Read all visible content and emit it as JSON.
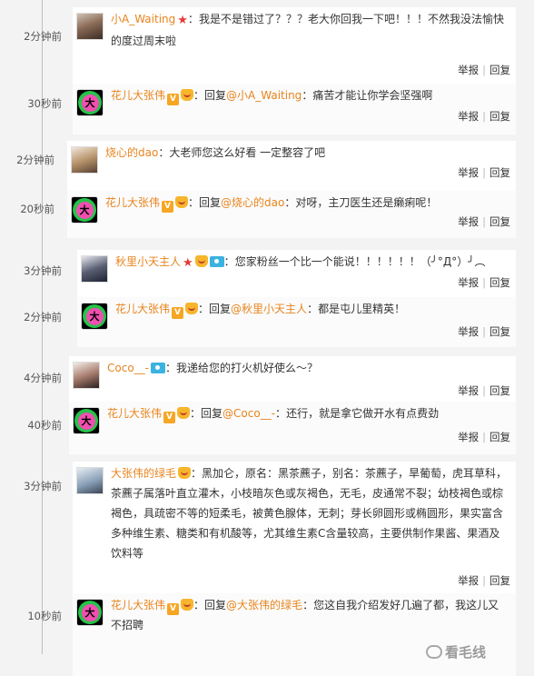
{
  "comments": [
    {
      "time": "2分钟前",
      "user": "小A_Waiting",
      "badges": [
        "star"
      ],
      "text": "我是不是错过了？？？老大你回我一下吧！！！不然我没法愉快的度过周末啦",
      "avatar": "p1"
    },
    {
      "time": "30秒前",
      "user": "花儿大张伟",
      "badges": [
        "v",
        "face"
      ],
      "reply_prefix": "回复",
      "reply_to": "@小A_Waiting",
      "text": "痛苦才能让你学会坚强啊",
      "avatar": "star"
    },
    {
      "time": "2分钟前",
      "user": "烧心的dao",
      "badges": [],
      "text": "大老师您这么好看 一定整容了吧",
      "avatar": "p2"
    },
    {
      "time": "20秒前",
      "user": "花儿大张伟",
      "badges": [
        "v",
        "face"
      ],
      "reply_prefix": "回复",
      "reply_to": "@烧心的dao",
      "text": "对呀，主刀医生还是癞痢呢！",
      "avatar": "star"
    },
    {
      "time": "3分钟前",
      "user": "秋里小天主人",
      "badges": [
        "star",
        "face",
        "cam"
      ],
      "text": "您家粉丝一个比一个能说！！！！！！（╯°Д°）╯︵",
      "avatar": "p3"
    },
    {
      "time": "2分钟前",
      "user": "花儿大张伟",
      "badges": [
        "v",
        "face"
      ],
      "reply_prefix": "回复",
      "reply_to": "@秋里小天主人",
      "text": "都是屯儿里精英！",
      "avatar": "star"
    },
    {
      "time": "4分钟前",
      "user": "Coco__-",
      "badges": [
        "cam"
      ],
      "text": "我递给您的打火机好使么～？",
      "avatar": "p4"
    },
    {
      "time": "40秒前",
      "user": "花儿大张伟",
      "badges": [
        "v",
        "face"
      ],
      "reply_prefix": "回复",
      "reply_to": "@Coco__-",
      "text": "还行，就是拿它做开水有点费劲",
      "avatar": "star"
    },
    {
      "time": "3分钟前",
      "user": "大张伟的绿毛",
      "badges": [
        "face"
      ],
      "text": "黑加仑，原名：黑茶藨子，别名：茶藨子，旱葡萄，虎耳草科，茶藨子属落叶直立灌木，小枝暗灰色或灰褐色，无毛，皮通常不裂；幼枝褐色或棕褐色，具疏密不等的短柔毛，被黄色腺体，无刺；芽长卵圆形或椭圆形，果实富含多种维生素、糖类和有机酸等，尤其维生素C含量较高，主要供制作果酱、果酒及饮料等",
      "avatar": "p5"
    },
    {
      "time": "10秒前",
      "user": "花儿大张伟",
      "badges": [
        "v",
        "face"
      ],
      "reply_prefix": "回复",
      "reply_to": "@大张伟的绿毛",
      "text": "您这自我介绍发好几遍了都，我这儿又不招聘",
      "avatar": "star"
    }
  ],
  "actions": {
    "report": "举报",
    "reply": "回复"
  },
  "separator": "：",
  "avatar_star_char": "大",
  "watermark": "看毛线",
  "colors": {
    "username": "#e8841d",
    "timeline": "#bdbdbd",
    "background": "#f3f3f3"
  }
}
